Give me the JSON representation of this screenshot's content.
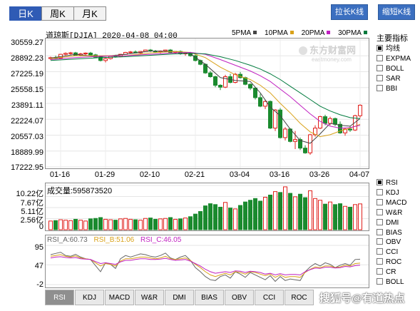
{
  "period_tabs": [
    {
      "label": "日K",
      "active": true
    },
    {
      "label": "周K",
      "active": false
    },
    {
      "label": "月K",
      "active": false
    }
  ],
  "buttons": {
    "stretch": "拉长K线",
    "shrink": "缩短K线"
  },
  "header": {
    "symbol": "道琼斯[DJIA] 2020-04-08 04:00"
  },
  "ma_legend": [
    {
      "label": "5PMA",
      "color": "#444444"
    },
    {
      "label": "10PMA",
      "color": "#d9a21a"
    },
    {
      "label": "20PMA",
      "color": "#c020c0"
    },
    {
      "label": "30PMA",
      "color": "#007a3d"
    }
  ],
  "indicator_panel": {
    "title": "主要指标",
    "items": [
      {
        "label": "均线",
        "checked": true
      },
      {
        "label": "EXPMA",
        "checked": false
      },
      {
        "label": "BOLL",
        "checked": false
      },
      {
        "label": "SAR",
        "checked": false
      },
      {
        "label": "BBI",
        "checked": false
      }
    ]
  },
  "sub_indicator_list": [
    {
      "label": "RSI",
      "checked": true
    },
    {
      "label": "KDJ",
      "checked": false
    },
    {
      "label": "MACD",
      "checked": false
    },
    {
      "label": "W&R",
      "checked": false
    },
    {
      "label": "DMI",
      "checked": false
    },
    {
      "label": "BIAS",
      "checked": false
    },
    {
      "label": "OBV",
      "checked": false
    },
    {
      "label": "CCI",
      "checked": false
    },
    {
      "label": "ROC",
      "checked": false
    },
    {
      "label": "CR",
      "checked": false
    },
    {
      "label": "BOLL",
      "checked": false
    }
  ],
  "bottom_tabs": [
    {
      "label": "RSI",
      "active": true
    },
    {
      "label": "KDJ",
      "active": false
    },
    {
      "label": "MACD",
      "active": false
    },
    {
      "label": "W&R",
      "active": false
    },
    {
      "label": "DMI",
      "active": false
    },
    {
      "label": "BIAS",
      "active": false
    },
    {
      "label": "OBV",
      "active": false
    },
    {
      "label": "CCI",
      "active": false
    },
    {
      "label": "ROC",
      "active": false
    }
  ],
  "watermark": {
    "logo": "东方财富网",
    "url": "eastmoney.com"
  },
  "footer_watermark": "搜狐号@有道热点",
  "volume": {
    "label": "成交量:595873520",
    "yticks": [
      "10.22亿",
      "7.67亿",
      "5.11亿",
      "2.56亿",
      "0"
    ]
  },
  "rsi": {
    "label_a": "RSI_A:60.73",
    "label_b": "RSI_B:51.06",
    "label_c": "RSI_C:46.05",
    "yticks": [
      "95",
      "47",
      "-2"
    ],
    "colors": {
      "a": "#666666",
      "b": "#d9a21a",
      "c": "#c020c0"
    }
  },
  "colors": {
    "up": "#e0201c",
    "down": "#1a8a2e"
  },
  "chart_data": {
    "type": "candlestick",
    "title": "道琼斯[DJIA]",
    "x_tick_labels": [
      "01-16",
      "01-29",
      "02-10",
      "02-21",
      "03-04",
      "03-16",
      "03-26",
      "04-07"
    ],
    "x_tick_index": [
      2,
      11,
      20,
      29,
      38,
      46,
      54,
      62
    ],
    "y_tick_labels": [
      "30559.27",
      "28892.23",
      "27225.19",
      "25558.15",
      "23891.11",
      "22224.07",
      "20557.03",
      "18889.99",
      "17222.95"
    ],
    "ylim": [
      17222.95,
      30559.27
    ],
    "candles": [
      {
        "o": 28600,
        "h": 28800,
        "l": 28450,
        "c": 28700
      },
      {
        "o": 28700,
        "h": 28900,
        "l": 28550,
        "c": 28650
      },
      {
        "o": 28650,
        "h": 29100,
        "l": 28600,
        "c": 29050
      },
      {
        "o": 29050,
        "h": 29250,
        "l": 28950,
        "c": 29150
      },
      {
        "o": 29150,
        "h": 29300,
        "l": 29000,
        "c": 29200
      },
      {
        "o": 29200,
        "h": 29300,
        "l": 28900,
        "c": 28950
      },
      {
        "o": 28950,
        "h": 29200,
        "l": 28850,
        "c": 29100
      },
      {
        "o": 29100,
        "h": 29250,
        "l": 28950,
        "c": 29180
      },
      {
        "o": 29180,
        "h": 29300,
        "l": 28900,
        "c": 28990
      },
      {
        "o": 28990,
        "h": 29100,
        "l": 28700,
        "c": 28750
      },
      {
        "o": 28750,
        "h": 28900,
        "l": 28300,
        "c": 28400
      },
      {
        "o": 28400,
        "h": 28700,
        "l": 28200,
        "c": 28600
      },
      {
        "o": 28600,
        "h": 28900,
        "l": 28500,
        "c": 28850
      },
      {
        "o": 28850,
        "h": 29000,
        "l": 28700,
        "c": 28800
      },
      {
        "o": 28800,
        "h": 29100,
        "l": 28750,
        "c": 29050
      },
      {
        "o": 29050,
        "h": 29300,
        "l": 29000,
        "c": 29250
      },
      {
        "o": 29250,
        "h": 29400,
        "l": 29100,
        "c": 29300
      },
      {
        "o": 29300,
        "h": 29450,
        "l": 29150,
        "c": 29200
      },
      {
        "o": 29200,
        "h": 29400,
        "l": 29100,
        "c": 29350
      },
      {
        "o": 29350,
        "h": 29550,
        "l": 29300,
        "c": 29500
      },
      {
        "o": 29500,
        "h": 29600,
        "l": 29300,
        "c": 29400
      },
      {
        "o": 29400,
        "h": 29500,
        "l": 29200,
        "c": 29300
      },
      {
        "o": 29300,
        "h": 29450,
        "l": 29150,
        "c": 29400
      },
      {
        "o": 29400,
        "h": 29550,
        "l": 29300,
        "c": 29500
      },
      {
        "o": 29500,
        "h": 29600,
        "l": 29200,
        "c": 29250
      },
      {
        "o": 29250,
        "h": 29400,
        "l": 29100,
        "c": 29350
      },
      {
        "o": 29350,
        "h": 29450,
        "l": 29000,
        "c": 29100
      },
      {
        "o": 29100,
        "h": 29250,
        "l": 28900,
        "c": 29200
      },
      {
        "o": 29200,
        "h": 29300,
        "l": 28800,
        "c": 28900
      },
      {
        "o": 28900,
        "h": 29000,
        "l": 28300,
        "c": 28400
      },
      {
        "o": 28400,
        "h": 28500,
        "l": 27900,
        "c": 28000
      },
      {
        "o": 28000,
        "h": 28100,
        "l": 27000,
        "c": 27100
      },
      {
        "o": 27100,
        "h": 27300,
        "l": 26600,
        "c": 26700
      },
      {
        "o": 26700,
        "h": 26800,
        "l": 25600,
        "c": 25800
      },
      {
        "o": 25800,
        "h": 25900,
        "l": 25300,
        "c": 25600
      },
      {
        "o": 25600,
        "h": 26900,
        "l": 25500,
        "c": 26700
      },
      {
        "o": 26700,
        "h": 27000,
        "l": 26000,
        "c": 26100
      },
      {
        "o": 26100,
        "h": 27100,
        "l": 26000,
        "c": 26950
      },
      {
        "o": 26950,
        "h": 27200,
        "l": 26500,
        "c": 26600
      },
      {
        "o": 26600,
        "h": 26700,
        "l": 25800,
        "c": 25900
      },
      {
        "o": 25900,
        "h": 26000,
        "l": 25300,
        "c": 25500
      },
      {
        "o": 25500,
        "h": 25600,
        "l": 24300,
        "c": 24500
      },
      {
        "o": 24500,
        "h": 24900,
        "l": 23500,
        "c": 23600
      },
      {
        "o": 23600,
        "h": 24300,
        "l": 23300,
        "c": 24100
      },
      {
        "o": 24100,
        "h": 24200,
        "l": 21200,
        "c": 21300
      },
      {
        "o": 21300,
        "h": 23300,
        "l": 21000,
        "c": 23200
      },
      {
        "o": 23200,
        "h": 23400,
        "l": 20200,
        "c": 20300
      },
      {
        "o": 20300,
        "h": 21400,
        "l": 20000,
        "c": 21200
      },
      {
        "o": 21200,
        "h": 21300,
        "l": 19800,
        "c": 19900
      },
      {
        "o": 19900,
        "h": 21000,
        "l": 19100,
        "c": 20100
      },
      {
        "o": 20100,
        "h": 20300,
        "l": 19000,
        "c": 19200
      },
      {
        "o": 19200,
        "h": 19500,
        "l": 18600,
        "c": 18700
      },
      {
        "o": 18700,
        "h": 20700,
        "l": 18500,
        "c": 20600
      },
      {
        "o": 20600,
        "h": 21600,
        "l": 20400,
        "c": 21300
      },
      {
        "o": 21300,
        "h": 22600,
        "l": 21200,
        "c": 22500
      },
      {
        "o": 22500,
        "h": 22700,
        "l": 21600,
        "c": 21800
      },
      {
        "o": 21800,
        "h": 22500,
        "l": 21600,
        "c": 22300
      },
      {
        "o": 22300,
        "h": 22400,
        "l": 21500,
        "c": 21700
      },
      {
        "o": 21700,
        "h": 22000,
        "l": 20700,
        "c": 20800
      },
      {
        "o": 20800,
        "h": 21300,
        "l": 20500,
        "c": 21200
      },
      {
        "o": 21200,
        "h": 21500,
        "l": 20900,
        "c": 21100
      },
      {
        "o": 21100,
        "h": 22700,
        "l": 21000,
        "c": 22600
      },
      {
        "o": 22600,
        "h": 23800,
        "l": 22400,
        "c": 23700
      }
    ],
    "ma": {
      "MA5": [
        [
          0,
          28650
        ],
        [
          5,
          29050
        ],
        [
          10,
          28800
        ],
        [
          15,
          29050
        ],
        [
          20,
          29400
        ],
        [
          25,
          29350
        ],
        [
          28,
          29100
        ],
        [
          31,
          28000
        ],
        [
          34,
          26600
        ],
        [
          37,
          26300
        ],
        [
          40,
          26200
        ],
        [
          42,
          25000
        ],
        [
          44,
          23500
        ],
        [
          46,
          22600
        ],
        [
          48,
          21200
        ],
        [
          50,
          20000
        ],
        [
          52,
          19700
        ],
        [
          54,
          20700
        ],
        [
          56,
          21800
        ],
        [
          58,
          21600
        ],
        [
          60,
          21500
        ],
        [
          62,
          22300
        ]
      ],
      "MA10": [
        [
          0,
          28600
        ],
        [
          5,
          28900
        ],
        [
          10,
          28900
        ],
        [
          15,
          28900
        ],
        [
          20,
          29200
        ],
        [
          25,
          29350
        ],
        [
          28,
          29250
        ],
        [
          31,
          28700
        ],
        [
          34,
          27700
        ],
        [
          37,
          26900
        ],
        [
          40,
          26400
        ],
        [
          42,
          25800
        ],
        [
          44,
          25000
        ],
        [
          46,
          23900
        ],
        [
          48,
          22900
        ],
        [
          50,
          21800
        ],
        [
          52,
          20900
        ],
        [
          54,
          20400
        ],
        [
          56,
          20600
        ],
        [
          58,
          21000
        ],
        [
          60,
          21300
        ],
        [
          62,
          21700
        ]
      ],
      "MA20": [
        [
          0,
          28500
        ],
        [
          5,
          28700
        ],
        [
          10,
          28850
        ],
        [
          15,
          28900
        ],
        [
          20,
          29050
        ],
        [
          25,
          29200
        ],
        [
          28,
          29250
        ],
        [
          31,
          29050
        ],
        [
          34,
          28500
        ],
        [
          37,
          27900
        ],
        [
          40,
          27300
        ],
        [
          42,
          26800
        ],
        [
          44,
          26200
        ],
        [
          46,
          25400
        ],
        [
          48,
          24600
        ],
        [
          50,
          23700
        ],
        [
          52,
          22800
        ],
        [
          54,
          22000
        ],
        [
          56,
          21500
        ],
        [
          58,
          21300
        ],
        [
          60,
          21350
        ],
        [
          62,
          21600
        ]
      ],
      "MA30": [
        [
          0,
          28400
        ],
        [
          5,
          28550
        ],
        [
          10,
          28700
        ],
        [
          15,
          28800
        ],
        [
          20,
          28950
        ],
        [
          25,
          29100
        ],
        [
          28,
          29150
        ],
        [
          31,
          29100
        ],
        [
          34,
          28800
        ],
        [
          37,
          28400
        ],
        [
          40,
          27900
        ],
        [
          42,
          27500
        ],
        [
          44,
          27000
        ],
        [
          46,
          26400
        ],
        [
          48,
          25700
        ],
        [
          50,
          25000
        ],
        [
          52,
          24300
        ],
        [
          54,
          23600
        ],
        [
          56,
          23100
        ],
        [
          58,
          22700
        ],
        [
          60,
          22400
        ],
        [
          62,
          22300
        ]
      ]
    },
    "volume": [
      2.0,
      2.1,
      2.3,
      2.2,
      2.1,
      2.4,
      2.2,
      2.0,
      2.5,
      2.6,
      2.8,
      2.4,
      2.3,
      2.2,
      2.5,
      2.6,
      2.4,
      2.3,
      2.2,
      2.6,
      2.7,
      2.4,
      2.5,
      2.6,
      2.8,
      2.4,
      2.5,
      2.7,
      3.0,
      3.6,
      4.2,
      5.5,
      6.0,
      5.8,
      5.2,
      6.3,
      5.0,
      4.8,
      5.6,
      6.4,
      6.8,
      7.2,
      6.6,
      7.5,
      8.0,
      8.8,
      8.6,
      9.9,
      8.4,
      7.6,
      8.2,
      7.4,
      9.0,
      7.2,
      6.8,
      5.9,
      6.4,
      5.8,
      6.0,
      5.4,
      5.2,
      5.8,
      5.96
    ],
    "rsi_a": [
      72,
      75,
      78,
      70,
      68,
      73,
      66,
      62,
      60,
      45,
      30,
      52,
      48,
      38,
      62,
      70,
      66,
      70,
      74,
      72,
      68,
      66,
      70,
      76,
      64,
      60,
      66,
      70,
      58,
      40,
      30,
      18,
      10,
      8,
      18,
      22,
      14,
      30,
      24,
      16,
      28,
      22,
      16,
      10,
      20,
      6,
      18,
      8,
      12,
      10,
      8,
      30,
      42,
      50,
      44,
      52,
      48,
      40,
      46,
      50,
      46,
      60,
      60.73
    ],
    "rsi_b": [
      68,
      70,
      72,
      68,
      66,
      69,
      64,
      62,
      60,
      52,
      44,
      50,
      48,
      44,
      56,
      62,
      62,
      64,
      66,
      66,
      64,
      62,
      64,
      68,
      62,
      60,
      62,
      64,
      58,
      48,
      40,
      30,
      22,
      18,
      22,
      26,
      22,
      30,
      28,
      24,
      30,
      28,
      24,
      20,
      24,
      16,
      22,
      16,
      18,
      18,
      16,
      28,
      36,
      42,
      40,
      44,
      44,
      40,
      42,
      46,
      44,
      50,
      51.06
    ],
    "rsi_c": [
      64,
      66,
      67,
      65,
      64,
      65,
      62,
      61,
      60,
      55,
      50,
      52,
      50,
      48,
      54,
      58,
      58,
      60,
      62,
      62,
      60,
      60,
      61,
      63,
      60,
      58,
      59,
      60,
      56,
      50,
      44,
      36,
      30,
      26,
      28,
      30,
      28,
      32,
      31,
      28,
      31,
      30,
      28,
      24,
      26,
      22,
      25,
      22,
      23,
      23,
      22,
      30,
      35,
      39,
      38,
      41,
      41,
      39,
      40,
      43,
      42,
      45,
      46.05
    ]
  }
}
